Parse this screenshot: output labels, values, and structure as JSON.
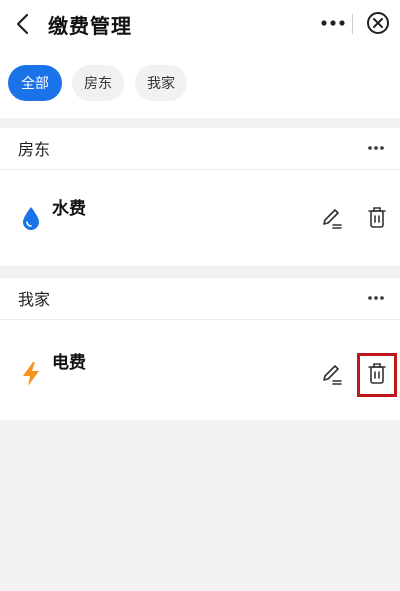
{
  "header": {
    "title": "缴费管理"
  },
  "filters": [
    {
      "label": "全部"
    },
    {
      "label": "房东"
    },
    {
      "label": "我家"
    }
  ],
  "groups": [
    {
      "name": "房东",
      "bills": [
        {
          "label": "水费",
          "icon": "water-drop-icon"
        }
      ]
    },
    {
      "name": "我家",
      "bills": [
        {
          "label": "电费",
          "icon": "lightning-icon"
        }
      ]
    }
  ],
  "colors": {
    "accent": "#1a73e8",
    "water": "#1a73e8",
    "electric": "#f7931e",
    "highlight": "#c01818"
  }
}
